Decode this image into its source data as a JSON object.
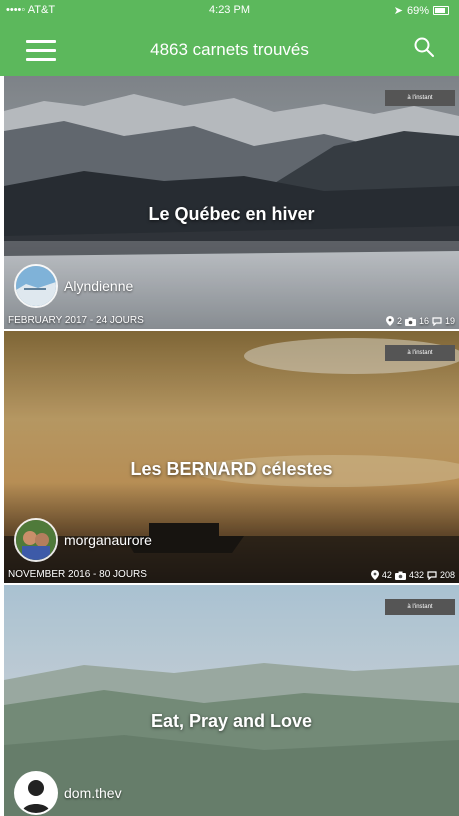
{
  "status_bar": {
    "carrier": "••••◦ AT&T",
    "time": "4:23 PM",
    "battery": "69%"
  },
  "nav": {
    "title": "4863 carnets trouvés"
  },
  "cards": [
    {
      "title": "Le Québec en hiver",
      "badge": "à l'instant",
      "author": "Alyndienne",
      "meta": "FEBRUARY 2017 - 24 JOURS",
      "stats": {
        "places": "2",
        "photos": "16",
        "comments": "19"
      }
    },
    {
      "title": "Les BERNARD célestes",
      "badge": "à l'instant",
      "author": "morganaurore",
      "meta": "NOVEMBER 2016 - 80 JOURS",
      "stats": {
        "places": "42",
        "photos": "432",
        "comments": "208"
      }
    },
    {
      "title": "Eat, Pray and Love",
      "badge": "à l'instant",
      "author": "dom.thev"
    }
  ],
  "colors": {
    "brand_green": "#5cb85c",
    "badge_bg": "#555555"
  },
  "icons": {
    "menu": "menu-icon",
    "search": "search-icon",
    "place": "map-pin-icon",
    "photo": "camera-icon",
    "comment": "comment-icon"
  }
}
